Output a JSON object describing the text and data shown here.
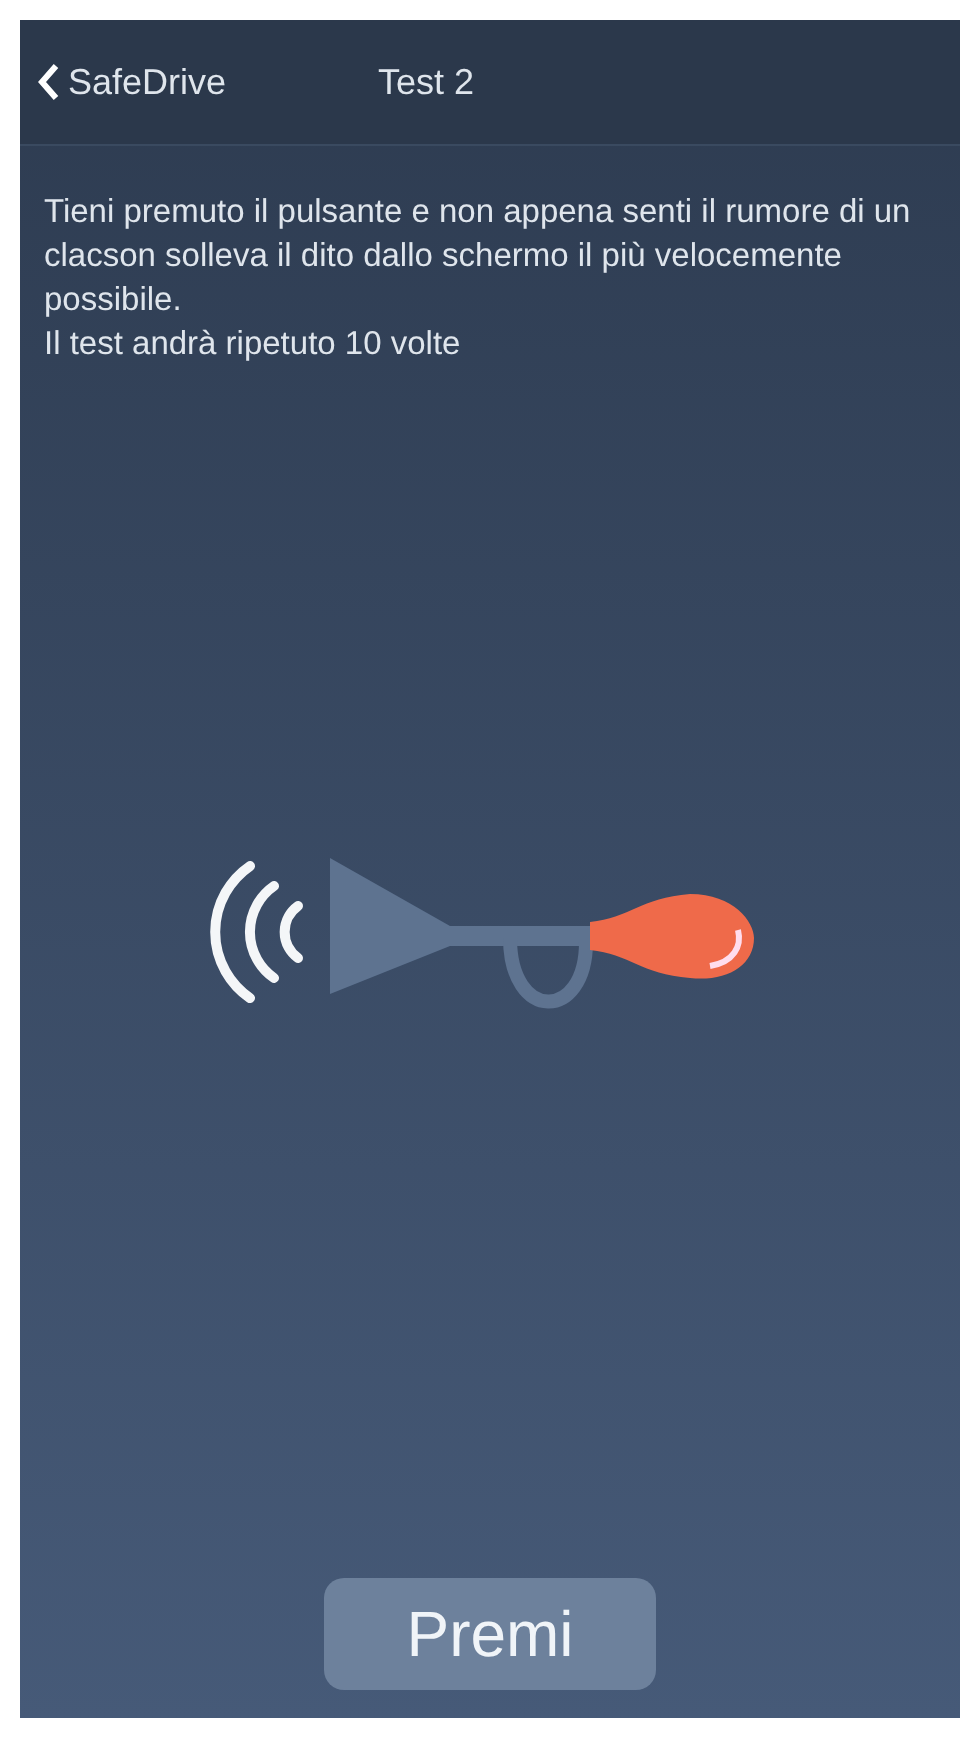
{
  "nav_bar": {
    "back_label": "SafeDrive",
    "title": "Test 2"
  },
  "instructions": [
    "Tieni premuto il pulsante e non appena senti il rumore di un clacson solleva il dito dallo schermo il più velocemente possibile.",
    "Il test andrà ripetuto 10 volte"
  ],
  "button": {
    "label": "Premi"
  }
}
